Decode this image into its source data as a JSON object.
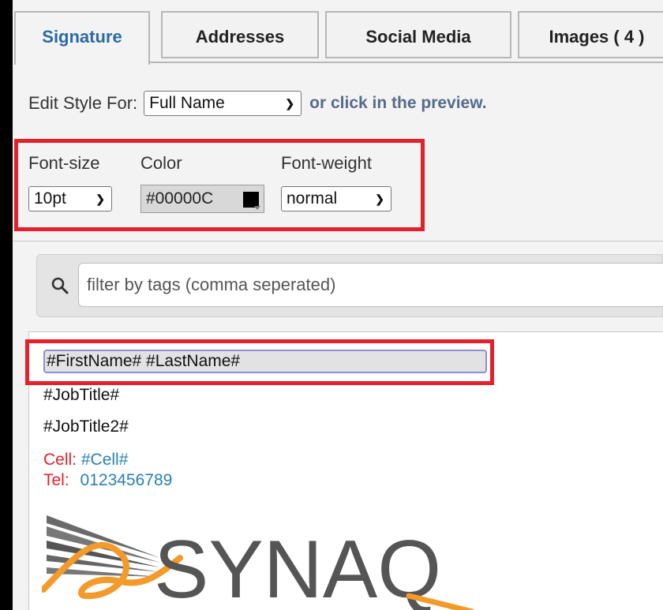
{
  "tabs": [
    {
      "label": "Signature",
      "active": true
    },
    {
      "label": "Addresses",
      "active": false
    },
    {
      "label": "Social Media",
      "active": false
    },
    {
      "label": "Images ( 4 )",
      "active": false
    }
  ],
  "edit_style": {
    "label": "Edit Style For:",
    "selected": "Full Name",
    "hint": "or click in the preview."
  },
  "font_controls": {
    "font_size_label": "Font-size",
    "font_size_value": "10pt",
    "color_label": "Color",
    "color_value": "#00000C",
    "font_weight_label": "Font-weight",
    "font_weight_value": "normal"
  },
  "filter": {
    "placeholder": "filter by tags (comma seperated)"
  },
  "preview": {
    "full_name": "#FirstName# #LastName#",
    "job_title": "#JobTitle#",
    "job_title2": "#JobTitle2#",
    "cell_label": "Cell:",
    "cell_value": "#Cell#",
    "tel_label": "Tel:",
    "tel_value": "0123456789",
    "logo_text": "SYNAQ"
  },
  "colors": {
    "active_tab": "#2b6aa6",
    "highlight_box": "#e3202b",
    "contact_label": "#e3202b",
    "contact_value": "#2a7fb5",
    "logo_orange": "#f39a2b",
    "logo_gray": "#555555"
  }
}
